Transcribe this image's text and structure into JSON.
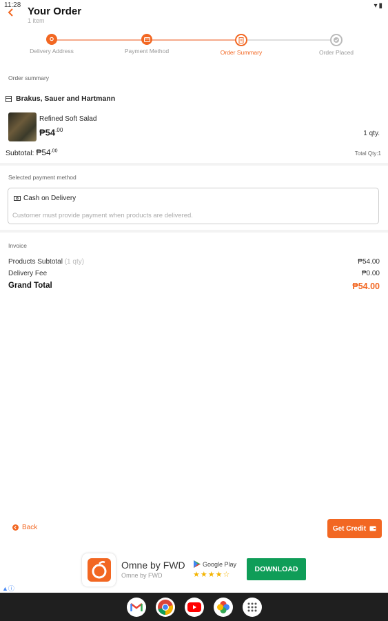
{
  "status_bar": {
    "time": "11:28"
  },
  "header": {
    "title": "Your Order",
    "subtitle": "1 item"
  },
  "stepper": [
    {
      "label": "Delivery Address",
      "state": "done"
    },
    {
      "label": "Payment Method",
      "state": "done"
    },
    {
      "label": "Order Summary",
      "state": "current"
    },
    {
      "label": "Order Placed",
      "state": "pending"
    }
  ],
  "summary": {
    "label": "Order summary",
    "store": "Brakus, Sauer and Hartmann",
    "product_name": "Refined Soft Salad",
    "product_price": "₱54",
    "product_price_cents": ".00",
    "qty": "1 qty.",
    "subtotal_label": "Subtotal:",
    "subtotal_amount": "₱54",
    "subtotal_cents": ".00",
    "total_qty": "Total Qty:1"
  },
  "payment": {
    "label": "Selected payment method",
    "method": "Cash on Delivery",
    "description": "Customer must provide payment when products are delivered."
  },
  "invoice": {
    "label": "Invoice",
    "products_subtotal_label": "Products Subtotal",
    "products_subtotal_qty": "(1 qty)",
    "products_subtotal_value": "₱54.00",
    "delivery_fee_label": "Delivery Fee",
    "delivery_fee_value": "₱0.00",
    "grand_total_label": "Grand Total",
    "grand_total_value": "₱54.00"
  },
  "actions": {
    "back": "Back",
    "get_credit": "Get Credit"
  },
  "ad": {
    "app_name": "Omne by FWD",
    "developer": "Omne by FWD",
    "store": "Google Play",
    "rating": "★★★★☆",
    "cta": "DOWNLOAD"
  },
  "colors": {
    "accent": "#f26722",
    "download": "#0f9d58"
  },
  "taskbar_apps": [
    "gmail-icon",
    "chrome-icon",
    "youtube-icon",
    "photos-icon",
    "app-drawer-icon"
  ]
}
